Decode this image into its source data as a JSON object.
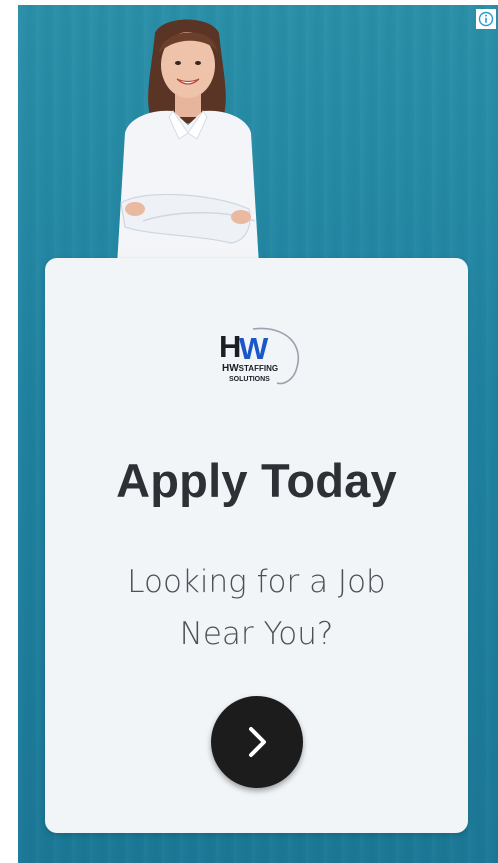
{
  "ad": {
    "info_icon": "info-icon",
    "brand": {
      "mark": "HW",
      "line1": "HW",
      "line1_suffix": "STAFFING",
      "line2": "SOLUTIONS"
    },
    "headline": "Apply Today",
    "subline_1": "Looking for a Job",
    "subline_2": "Near You?",
    "cta_icon": "chevron-right-icon"
  },
  "colors": {
    "background_teal": "#1f82a0",
    "card": "#f1f5f8",
    "headline": "#2d3035",
    "button": "#1c1c1c",
    "logo_blue": "#1a57c9"
  }
}
